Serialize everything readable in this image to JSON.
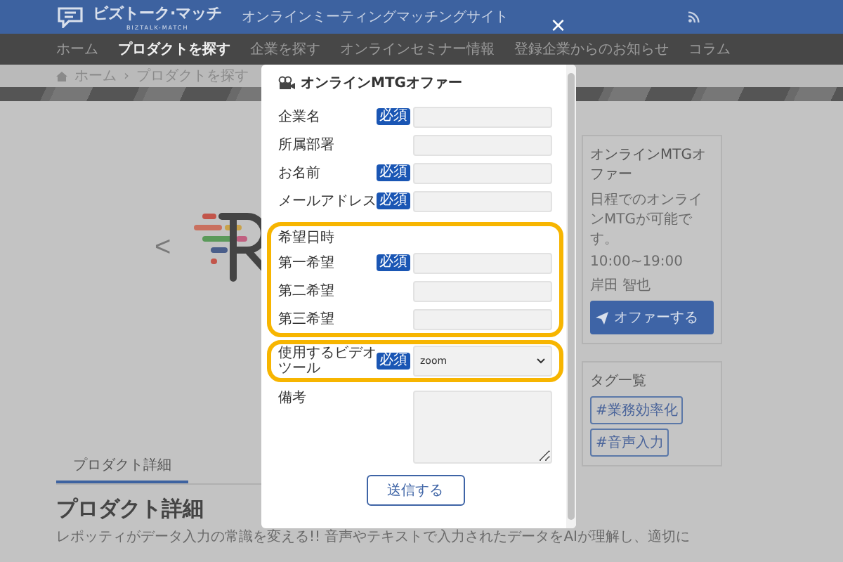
{
  "header": {
    "logo": "ビズトーク·マッチ",
    "logo_sub": "BIZTALK-MATCH",
    "tagline": "オンラインミーティングマッチングサイト"
  },
  "nav": [
    {
      "label": "ホーム",
      "selected": false
    },
    {
      "label": "プロダクトを探す",
      "selected": true
    },
    {
      "label": "企業を探す",
      "selected": false
    },
    {
      "label": "オンラインセミナー情報",
      "selected": false
    },
    {
      "label": "登録企業からのお知らせ",
      "selected": false
    },
    {
      "label": "コラム",
      "selected": false
    }
  ],
  "breadcrumb": [
    "ホーム",
    "›",
    "プロダクトを探す"
  ],
  "carousel": {
    "prev": "<"
  },
  "detail_tabs": [
    {
      "label": "プロダクト詳細",
      "selected": true
    }
  ],
  "detail": {
    "heading": "プロダクト詳細",
    "text": "レポッティがデータ入力の常識を変える!! 音声やテキストで入力されたデータをAIが理解し、適切に"
  },
  "offer_card": {
    "title": "オンラインMTGオファー",
    "lines": [
      "日程でのオンラインMTGが可能です。",
      "10:00~19:00",
      "岸田 智也"
    ],
    "button": "オファーする"
  },
  "tags_card": {
    "title": "タグ一覧",
    "tags": [
      "#業務効率化",
      "#音声入力"
    ]
  },
  "modal": {
    "close": "×",
    "title": "オンラインMTGオファー",
    "submit": "送信する",
    "groups": [
      {
        "highlighted": false,
        "fields": [
          {
            "label": "企業名",
            "badge": "必須",
            "kind": "text"
          },
          {
            "label": "所属部署",
            "kind": "text"
          },
          {
            "label": "お名前",
            "badge": "必須",
            "kind": "text"
          },
          {
            "label": "メールアドレス",
            "badge": "必須",
            "kind": "text"
          }
        ]
      },
      {
        "highlighted": true,
        "title": "希望日時",
        "fields": [
          {
            "label": "第一希望",
            "badge": "必須",
            "kind": "text"
          },
          {
            "label": "第二希望",
            "kind": "text"
          },
          {
            "label": "第三希望",
            "kind": "text"
          }
        ]
      },
      {
        "highlighted": true,
        "fields": [
          {
            "label": "使用するビデオツール",
            "badge": "必須",
            "kind": "select",
            "value": "zoom"
          }
        ]
      },
      {
        "highlighted": false,
        "fields": [
          {
            "label": "備考",
            "kind": "textarea"
          }
        ]
      }
    ]
  }
}
